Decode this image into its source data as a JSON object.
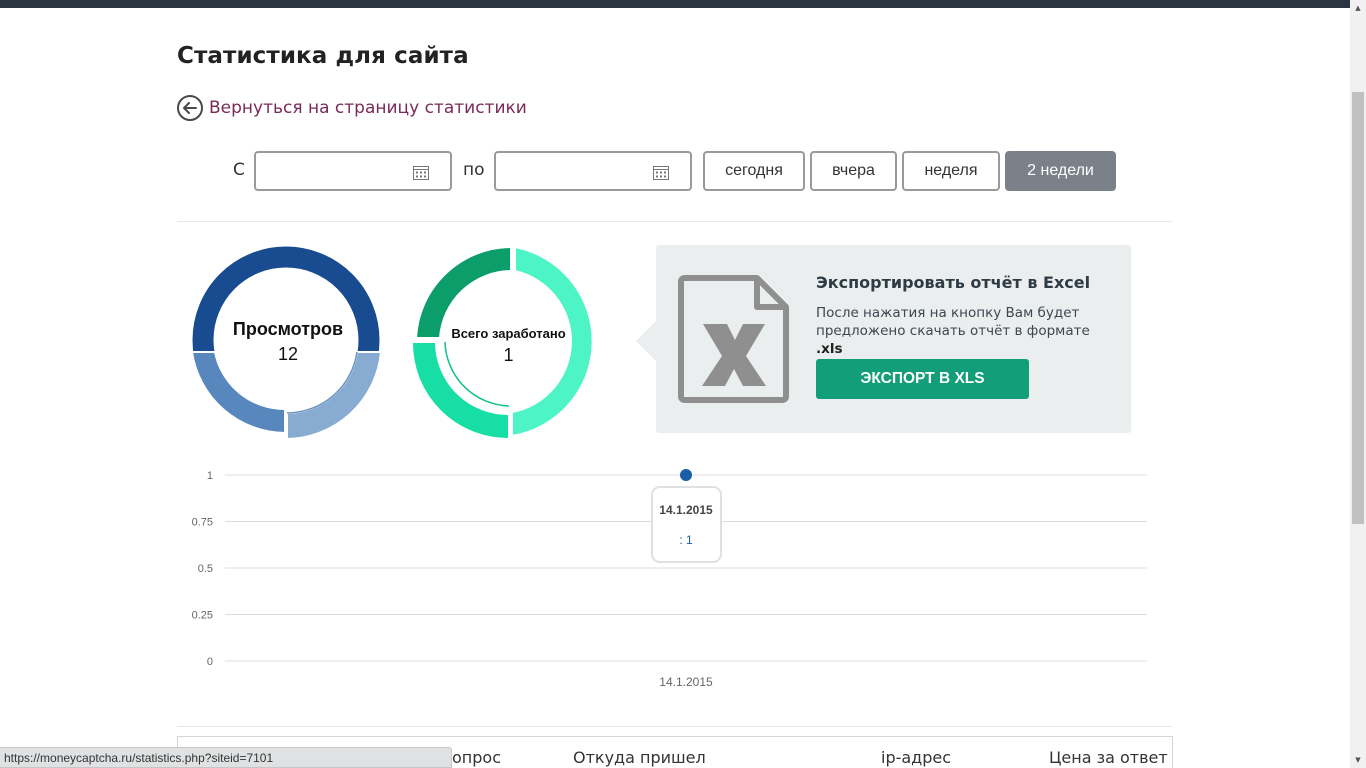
{
  "page": {
    "title": "Статистика для сайта",
    "back_link": "Вернуться на страницу статистики"
  },
  "filters": {
    "from_label": "С",
    "to_label": "по",
    "from_value": "",
    "to_value": "",
    "periods": [
      "сегодня",
      "вчера",
      "неделя",
      "2 недели"
    ],
    "active_period": "2 недели"
  },
  "views_donut": {
    "label": "Просмотров",
    "value": "12",
    "colors": [
      "#184b8f",
      "#87abd1",
      "#5887bd"
    ]
  },
  "earned_donut": {
    "label": "Всего заработано",
    "value": "1",
    "colors": [
      "#4cf4c6",
      "#17dea5",
      "#0b9e6b"
    ]
  },
  "export": {
    "title": "Экспортировать отчёт в Excel",
    "desc_text": "После нажатия на кнопку Вам будет предложено скачать отчёт в формате",
    "desc_ext": ".xls",
    "button": "ЭКСПОРТ В XLS",
    "button_color": "#129e78"
  },
  "chart_data": {
    "type": "line",
    "x": [
      "14.1.2015"
    ],
    "series": [
      {
        "values": [
          1
        ]
      }
    ],
    "ylim": [
      0,
      1
    ],
    "yticks": [
      "0",
      "0.25",
      "0.5",
      "0.75",
      "1"
    ],
    "point_color": "#1b5fa8",
    "tooltip": {
      "title": "14.1.2015",
      "text": ": 1"
    }
  },
  "table": {
    "headers": [
      "опрос",
      "Откуда пришел",
      "ip-адрес",
      "Цена за ответ"
    ]
  },
  "status_bar": {
    "url": "https://moneycaptcha.ru/statistics.php?siteid=7101"
  }
}
